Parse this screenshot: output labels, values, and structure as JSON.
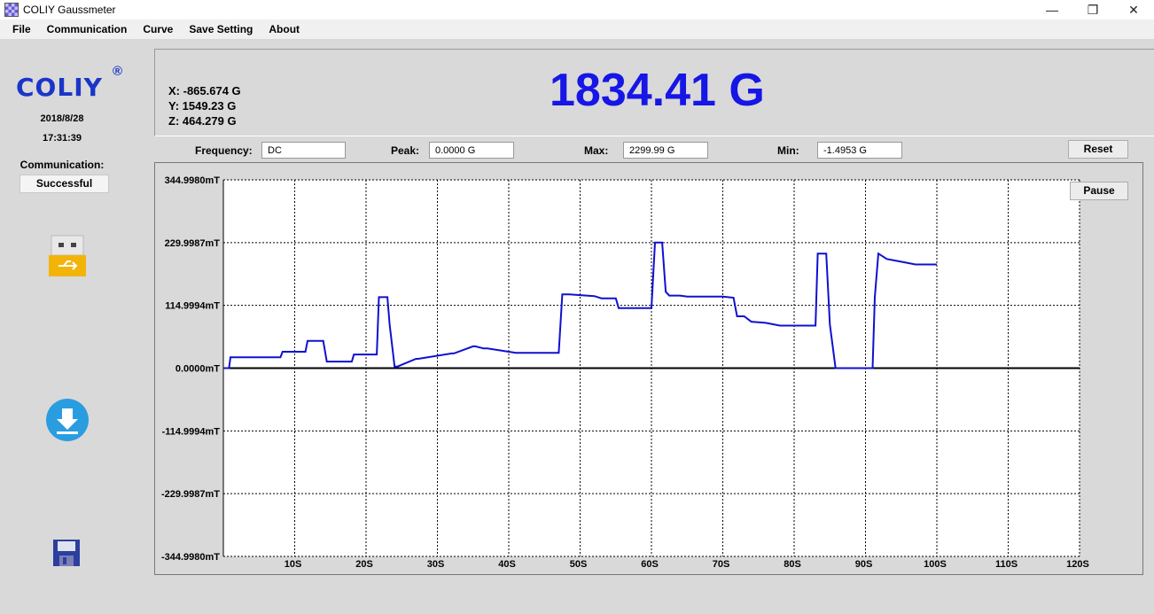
{
  "window": {
    "title": "COLIY Gaussmeter",
    "controls": [
      "—",
      "❐",
      "✕"
    ]
  },
  "menu": [
    "File",
    "Communication",
    "Curve",
    "Save Setting",
    "About"
  ],
  "sidebar": {
    "logo": "COLIY",
    "logo_mark": "®",
    "date": "2018/8/28",
    "time": "17:31:39",
    "communication_label": "Communication:",
    "communication_status": "Successful",
    "icons": [
      "usb-drive-icon",
      "download-icon",
      "save-disk-icon"
    ]
  },
  "readout": {
    "x": "X:  -865.674 G",
    "y": "Y:    1549.23 G",
    "z": "Z:   464.279 G",
    "magnitude": "1834.41 G"
  },
  "fields": {
    "frequency_label": "Frequency:",
    "frequency_value": "DC",
    "peak_label": "Peak:",
    "peak_value": "0.0000 G",
    "max_label": "Max:",
    "max_value": "2299.99 G",
    "min_label": "Min:",
    "min_value": "-1.4953 G"
  },
  "buttons": {
    "reset": "Reset",
    "pause": "Pause"
  },
  "colors": {
    "accent": "#1616e6",
    "logo": "#1a35c8",
    "series": "#1010d0"
  },
  "chart_data": {
    "type": "line",
    "ylim": [
      -344.998,
      344.998
    ],
    "xlim": [
      0,
      120
    ],
    "y_tick_labels": [
      "344.9980mT",
      "229.9987mT",
      "114.9994mT",
      "0.0000mT",
      "-114.9994mT",
      "-229.9987mT",
      "-344.9980mT"
    ],
    "y_ticks": [
      344.998,
      229.9987,
      114.9994,
      0,
      -114.9994,
      -229.9987,
      -344.998
    ],
    "x_tick_labels": [
      "10S",
      "20S",
      "30S",
      "40S",
      "50S",
      "60S",
      "70S",
      "80S",
      "90S",
      "100S",
      "110S",
      "120S"
    ],
    "x_ticks": [
      10,
      20,
      30,
      40,
      50,
      60,
      70,
      80,
      90,
      100,
      110,
      120
    ],
    "grid": true,
    "series": [
      {
        "x": [
          0,
          0.8,
          1.0,
          8,
          8.3,
          11.5,
          11.8,
          14,
          14.5,
          18,
          18.3,
          21.5,
          21.8,
          23,
          23.3,
          24,
          24.4,
          27,
          27.3,
          32,
          32.3,
          35,
          35.3,
          36.5,
          37,
          41,
          41.3,
          47,
          47.5,
          48.5,
          52,
          53,
          55,
          55.4,
          60,
          60.5,
          61.5,
          62,
          62.5,
          64,
          65,
          70,
          71.5,
          72,
          73,
          74,
          76,
          78,
          80,
          83,
          83.3,
          84.5,
          85,
          85.8,
          86,
          91,
          91.3,
          91.8,
          93,
          95,
          97,
          100
        ],
        "y": [
          0,
          0,
          20,
          20,
          30,
          30,
          50,
          50,
          12,
          12,
          25,
          25,
          130,
          130,
          80,
          3,
          3,
          17,
          17,
          27,
          27,
          40,
          40,
          36,
          36,
          28,
          28,
          28,
          135,
          135,
          132,
          128,
          128,
          110,
          110,
          230,
          230,
          140,
          133,
          133,
          131,
          131,
          129,
          95,
          95,
          85,
          83,
          78,
          78,
          78,
          210,
          210,
          80,
          0,
          0,
          0,
          130,
          210,
          200,
          195,
          190,
          190
        ]
      }
    ]
  }
}
